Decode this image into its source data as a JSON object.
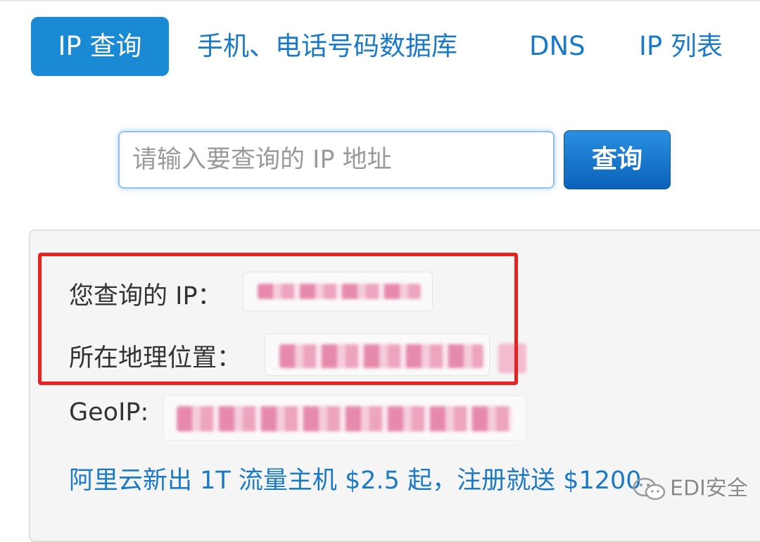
{
  "nav": {
    "tabs": [
      {
        "label": "IP 查询",
        "active": true
      },
      {
        "label": "手机、电话号码数据库",
        "active": false
      },
      {
        "label": "DNS",
        "active": false
      },
      {
        "label": "IP 列表",
        "active": false
      }
    ]
  },
  "search": {
    "placeholder": "请输入要查询的 IP 地址",
    "value": "",
    "button_label": "查询"
  },
  "result": {
    "ip_label": "您查询的 IP：",
    "location_label": "所在地理位置：",
    "geoip_label": "GeoIP:",
    "promo_link": "阿里云新出 1T 流量主机 $2.5 起，注册就送 $1200"
  },
  "watermark": {
    "text": "EDI安全",
    "icon": "wechat-icon"
  },
  "colors": {
    "accent": "#1a8ad4",
    "link": "#1a7ac7",
    "highlight_border": "#e8231f",
    "panel_background": "#f5f5f5"
  }
}
